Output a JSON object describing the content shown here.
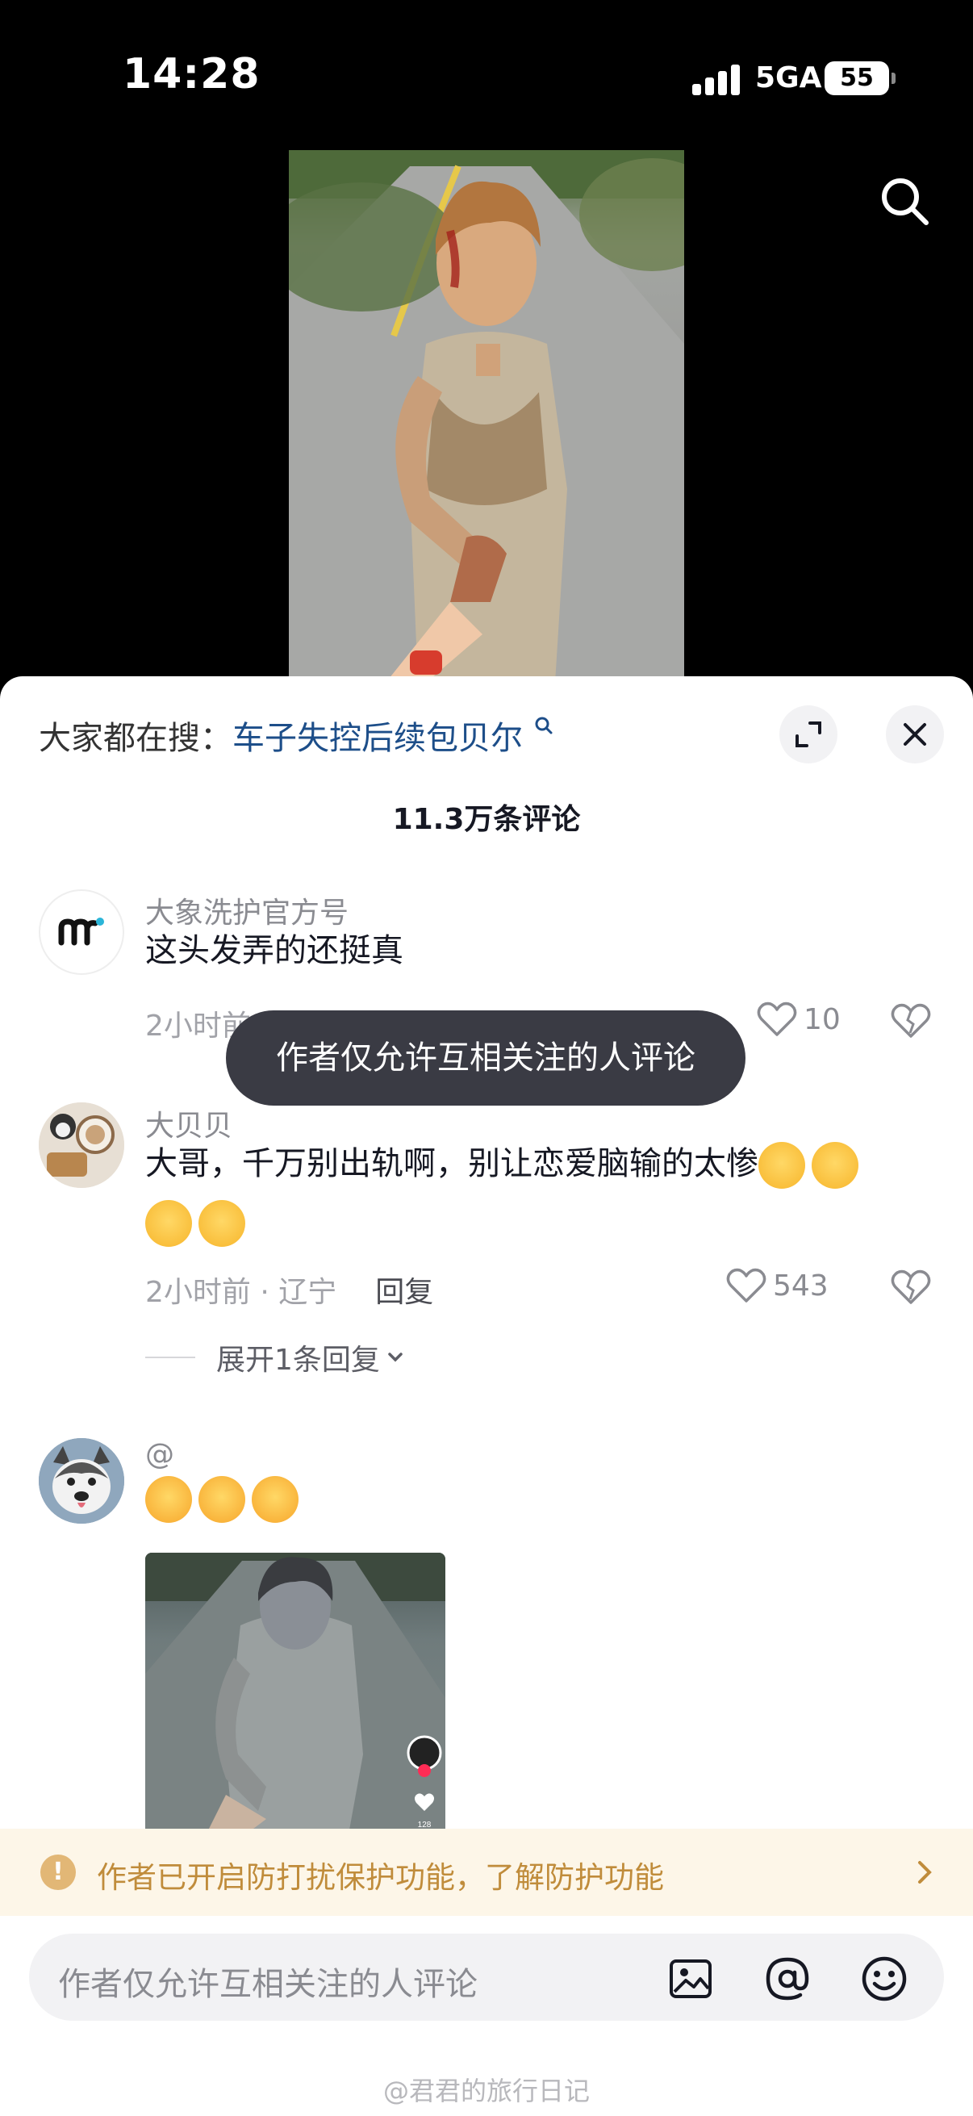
{
  "status_bar": {
    "time": "14:28",
    "network": "5GA",
    "battery": "55"
  },
  "video": {
    "search_icon": "search-icon"
  },
  "sheet": {
    "hot_search_prefix": "大家都在搜：",
    "hot_search_term": "车子失控后续包贝尔",
    "comment_count": "11.3万条评论"
  },
  "comments": [
    {
      "author": "大象洗护官方号",
      "text": "这头发弄的还挺真",
      "time": "2小时前",
      "likes": "10"
    },
    {
      "author": "大贝贝",
      "text": "大哥，千万别出轨啊，别让恋爱脑输的太惨",
      "time_location": "2小时前 · 辽宁",
      "reply_label": "回复",
      "likes": "543",
      "expand_replies": "展开1条回复"
    },
    {
      "author": "@",
      "image_likes": "128"
    }
  ],
  "toast": {
    "text": "作者仅允许互相关注的人评论"
  },
  "protect_banner": {
    "text": "作者已开启防打扰保护功能，了解防护功能"
  },
  "input_bar": {
    "placeholder": "作者仅允许互相关注的人评论"
  },
  "watermark": {
    "text": "@君君的旅行日记"
  },
  "colors": {
    "link": "#1d4e89",
    "banner_bg": "#fdf6e8",
    "banner_text": "#c08c3b",
    "toast_bg": "#3a3b44"
  }
}
